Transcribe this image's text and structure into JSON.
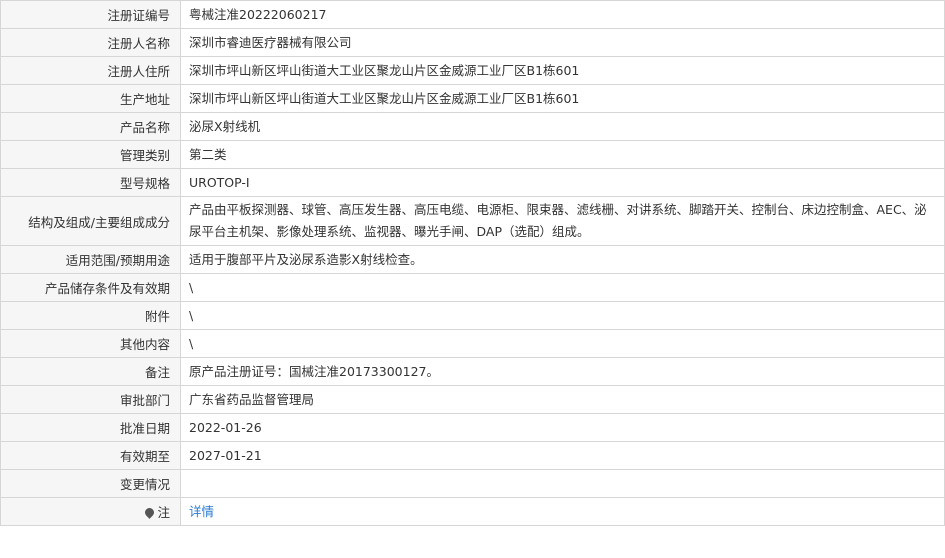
{
  "rows": [
    {
      "label": "注册证编号",
      "value": "粤械注准20222060217"
    },
    {
      "label": "注册人名称",
      "value": "深圳市睿迪医疗器械有限公司"
    },
    {
      "label": "注册人住所",
      "value": "深圳市坪山新区坪山街道大工业区聚龙山片区金威源工业厂区B1栋601"
    },
    {
      "label": "生产地址",
      "value": "深圳市坪山新区坪山街道大工业区聚龙山片区金威源工业厂区B1栋601"
    },
    {
      "label": "产品名称",
      "value": "泌尿X射线机"
    },
    {
      "label": "管理类别",
      "value": "第二类"
    },
    {
      "label": "型号规格",
      "value": "UROTOP-I"
    },
    {
      "label": "结构及组成/主要组成成分",
      "value": "产品由平板探测器、球管、高压发生器、高压电缆、电源柜、限束器、滤线栅、对讲系统、脚踏开关、控制台、床边控制盒、AEC、泌尿平台主机架、影像处理系统、监视器、曝光手闸、DAP（选配）组成。"
    },
    {
      "label": "适用范围/预期用途",
      "value": "适用于腹部平片及泌尿系造影X射线检查。"
    },
    {
      "label": "产品储存条件及有效期",
      "value": "\\"
    },
    {
      "label": "附件",
      "value": "\\"
    },
    {
      "label": "其他内容",
      "value": "\\"
    },
    {
      "label": "备注",
      "value": "原产品注册证号：国械注准20173300127。"
    },
    {
      "label": "审批部门",
      "value": "广东省药品监督管理局"
    },
    {
      "label": "批准日期",
      "value": "2022-01-26"
    },
    {
      "label": "有效期至",
      "value": "2027-01-21"
    },
    {
      "label": "变更情况",
      "value": ""
    }
  ],
  "note": {
    "icon": "pin-icon",
    "label": "注",
    "link_text": "详情"
  }
}
